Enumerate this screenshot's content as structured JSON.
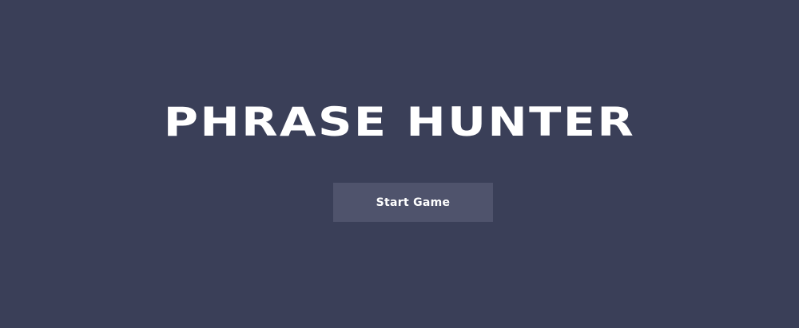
{
  "overlay": {
    "title": "PHRASE HUNTER",
    "start_button_label": "Start Game"
  }
}
